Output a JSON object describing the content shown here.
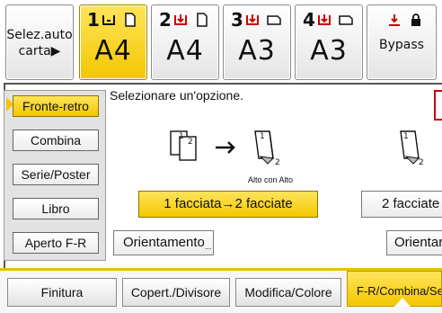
{
  "tray_bar": {
    "auto_select": {
      "line1": "Selez.auto",
      "line2": "carta▶"
    },
    "trays": [
      {
        "number": "1",
        "size": "A4",
        "selected": true
      },
      {
        "number": "2",
        "size": "A4",
        "selected": false
      },
      {
        "number": "3",
        "size": "A3",
        "selected": false
      },
      {
        "number": "4",
        "size": "A3",
        "selected": false
      }
    ],
    "bypass": {
      "label": "Bypass"
    }
  },
  "sidebar": {
    "items": [
      {
        "label": "Fronte-retro",
        "active": true
      },
      {
        "label": "Combina",
        "active": false
      },
      {
        "label": "Serie/Poster",
        "active": false
      },
      {
        "label": "Libro",
        "active": false
      },
      {
        "label": "Aperto F-R",
        "active": false
      }
    ]
  },
  "main": {
    "prompt": "Selezionare un'opzione.",
    "diagram": {
      "source_pages": [
        "1",
        "2"
      ],
      "result_front": "1",
      "result_back": "2",
      "caption": "Alto con Alto",
      "right_front": "1",
      "right_back": "2"
    },
    "options": {
      "one_to_two": "1 facciata→2 facciate",
      "two_to_two": "2 facciate"
    },
    "orientation_label": "Orientamento",
    "orientation_dots": "...",
    "orientation_right_label": "Orientar"
  },
  "tabs": [
    {
      "label": "Finitura",
      "active": false
    },
    {
      "label": "Copert./Divisore",
      "active": false
    },
    {
      "label": "Modifica/Colore",
      "active": false
    },
    {
      "label": "F-R/Combina/Seri",
      "active": true
    }
  ],
  "colors": {
    "accent": "#f3c700",
    "tray_icon": "#cc0000"
  }
}
